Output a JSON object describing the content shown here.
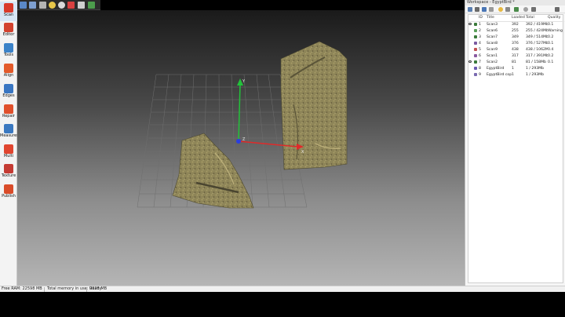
{
  "sidebar": {
    "items": [
      {
        "label": "Scan",
        "icon": "scan-icon",
        "color": "#d93a2b"
      },
      {
        "label": "Editor",
        "icon": "editor-icon",
        "color": "#d3422e"
      },
      {
        "label": "Tools",
        "icon": "tools-icon",
        "color": "#3b82c8"
      },
      {
        "label": "Align",
        "icon": "align-icon",
        "color": "#e35a2a"
      },
      {
        "label": "Edges",
        "icon": "edges-icon",
        "color": "#3976c2"
      },
      {
        "label": "Repair",
        "icon": "repair-icon",
        "color": "#e0502c"
      },
      {
        "label": "Measures",
        "icon": "measures-icon",
        "color": "#3a78c0"
      },
      {
        "label": "Multi",
        "icon": "multi-icon",
        "color": "#e0452f"
      },
      {
        "label": "Texture",
        "icon": "texture-icon",
        "color": "#c43b33"
      },
      {
        "label": "Publish",
        "icon": "publish-icon",
        "color": "#d94c2a"
      }
    ]
  },
  "top_toolbar": {
    "buttons": [
      {
        "icon": "back-icon",
        "color": "#5a88c8"
      },
      {
        "icon": "grid-icon",
        "color": "#7e9fd0"
      },
      {
        "icon": "axes-icon",
        "color": "#b4b4b4"
      },
      {
        "icon": "light-icon",
        "color": "#e8c74a"
      },
      {
        "icon": "texture-sphere-icon",
        "color": "#d9d9d9"
      },
      {
        "icon": "shaded-cube-icon",
        "color": "#d94040"
      },
      {
        "icon": "wire-cube-icon",
        "color": "#cfcfcf"
      },
      {
        "icon": "color-icon",
        "color": "#4c9c4c"
      }
    ]
  },
  "workspace": {
    "title": "Workspace - EgyptBird *",
    "columns": {
      "id": "ID",
      "title": "Title",
      "loaded": "Loaded",
      "total": "Total",
      "quality": "Quality"
    },
    "rows": [
      {
        "visible": true,
        "color": "#3a7a3a",
        "id": "1",
        "title": "Scan3",
        "loaded": "392",
        "total": "392 / 419Mb",
        "quality": "0.1"
      },
      {
        "visible": false,
        "color": "#5aa05a",
        "id": "2",
        "title": "Scan6",
        "loaded": "255",
        "total": "255 / 424Mb",
        "quality": "Warning"
      },
      {
        "visible": false,
        "color": "#3a7a3a",
        "id": "3",
        "title": "Scan7",
        "loaded": "349",
        "total": "349 / 514Mb",
        "quality": "0.2"
      },
      {
        "visible": false,
        "color": "#7a5aa0",
        "id": "4",
        "title": "Scan8",
        "loaded": "376",
        "total": "376 / 527Mb",
        "quality": "0.1"
      },
      {
        "visible": false,
        "color": "#c05050",
        "id": "5",
        "title": "Scan9",
        "loaded": "438",
        "total": "438 / 1062Mb",
        "quality": "0.4"
      },
      {
        "visible": false,
        "color": "#8a5aa0",
        "id": "6",
        "title": "Scan1",
        "loaded": "317",
        "total": "317 / 391Mb",
        "quality": "0.2"
      },
      {
        "visible": true,
        "color": "#3a7a3a",
        "id": "7",
        "title": "Scan2",
        "loaded": "81",
        "total": "81 / 158Mb",
        "quality": "0.1"
      },
      {
        "visible": false,
        "color": "#6a5ab0",
        "id": "8",
        "title": "EgyptBird",
        "loaded": "1",
        "total": "1 / 293Mb",
        "quality": ""
      },
      {
        "visible": false,
        "color": "#7a6ab0",
        "id": "9",
        "title": "EgyptBird cop",
        "loaded": "1",
        "total": "1 / 293Mb",
        "quality": ""
      }
    ]
  },
  "viewport": {
    "axis_x_label": "X",
    "axis_y_label": "Y",
    "axis_z_label": "Z",
    "axis_colors": {
      "x": "#e02a2a",
      "y": "#22c23a",
      "z": "#2a3ee0"
    }
  },
  "statusbar": {
    "free_ram": "Free RAM: 22598 MB",
    "total_memory": "Total memory in use: 9928 MB",
    "status": "Ready"
  }
}
